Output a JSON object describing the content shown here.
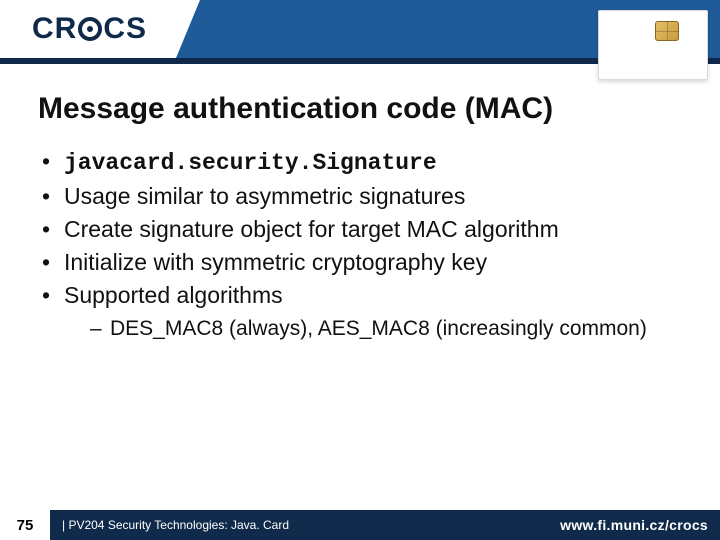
{
  "header": {
    "logo_left": "CR",
    "logo_right": "CS"
  },
  "title": "Message authentication code (MAC)",
  "bullets": [
    {
      "text": "javacard.security.Signature",
      "mono": true
    },
    {
      "text": "Usage similar to asymmetric signatures"
    },
    {
      "text": "Create signature object for target MAC algorithm"
    },
    {
      "text": "Initialize with symmetric cryptography key"
    },
    {
      "text": "Supported algorithms",
      "sub": [
        "DES_MAC8 (always), AES_MAC8 (increasingly common)"
      ]
    }
  ],
  "footer": {
    "page": "75",
    "course": "| PV204 Security Technologies: Java. Card",
    "site": "www.fi.muni.cz/crocs"
  }
}
